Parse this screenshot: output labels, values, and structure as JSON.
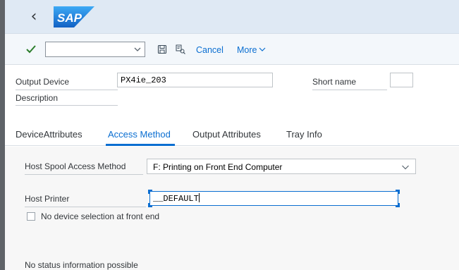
{
  "toolbar": {
    "command_value": "",
    "cancel_label": "Cancel",
    "more_label": "More"
  },
  "form": {
    "output_device_label": "Output Device",
    "output_device_value": "PX4ie_203",
    "short_name_label": "Short name",
    "short_name_value": "",
    "description_label": "Description"
  },
  "tabs": [
    {
      "label": "DeviceAttributes",
      "active": false
    },
    {
      "label": "Access Method",
      "active": true
    },
    {
      "label": "Output Attributes",
      "active": false
    },
    {
      "label": "Tray Info",
      "active": false
    }
  ],
  "access_method": {
    "host_spool_label": "Host Spool Access Method",
    "host_spool_value": "F: Printing on Front End Computer",
    "host_printer_label": "Host Printer",
    "host_printer_value": "__DEFAULT",
    "no_device_selection_label": "No device selection at front end",
    "no_device_selection_checked": false,
    "status_text": "No status information possible"
  },
  "colors": {
    "accent": "#0a6ed1",
    "check_green": "#2b7d2b",
    "shellbar_bg": "#dfe9f4",
    "sap_blue": "#1a73c9"
  },
  "icons": [
    "back-icon",
    "sap-logo",
    "check-icon",
    "chevron-down-icon",
    "save-icon",
    "find-icon"
  ]
}
